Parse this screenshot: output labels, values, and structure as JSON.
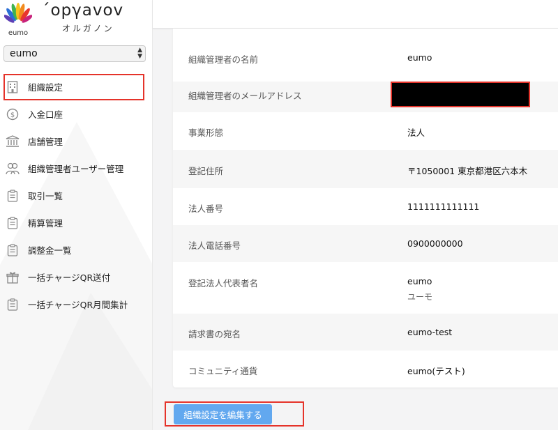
{
  "brand": {
    "name": "΄opγavov",
    "kana": "オルガノン",
    "logo_text": "eumo"
  },
  "org_selector": {
    "value": "eumo"
  },
  "nav": [
    {
      "label": "組織設定",
      "icon": "building-icon",
      "active": true
    },
    {
      "label": "入金口座",
      "icon": "dollar-circle-icon"
    },
    {
      "label": "店舗管理",
      "icon": "bank-icon"
    },
    {
      "label": "組織管理者ユーザー管理",
      "icon": "users-icon"
    },
    {
      "label": "取引一覧",
      "icon": "clipboard-icon"
    },
    {
      "label": "精算管理",
      "icon": "clipboard-icon"
    },
    {
      "label": "調整金一覧",
      "icon": "clipboard-icon"
    },
    {
      "label": "一括チャージQR送付",
      "icon": "gift-icon"
    },
    {
      "label": "一括チャージQR月間集計",
      "icon": "clipboard-icon"
    }
  ],
  "details": [
    {
      "label": "組織管理者の名前",
      "value": "eumo"
    },
    {
      "label": "組織管理者のメールアドレス",
      "value": ""
    },
    {
      "label": "事業形態",
      "value": "法人"
    },
    {
      "label": "登記住所",
      "value": "〒1050001 東京都港区六本木"
    },
    {
      "label": "法人番号",
      "value": "1111111111111"
    },
    {
      "label": "法人電話番号",
      "value": "0900000000"
    },
    {
      "label": "登記法人代表者名",
      "value": "eumo",
      "value_kana": "ユーモ"
    },
    {
      "label": "請求書の宛名",
      "value": "eumo-test"
    },
    {
      "label": "コミュニティ通貨",
      "value": "eumo(テスト)"
    }
  ],
  "edit_button": {
    "label": "組織設定を編集する"
  },
  "colors": {
    "accent": "#62a8ef",
    "highlight": "#e5332a"
  }
}
